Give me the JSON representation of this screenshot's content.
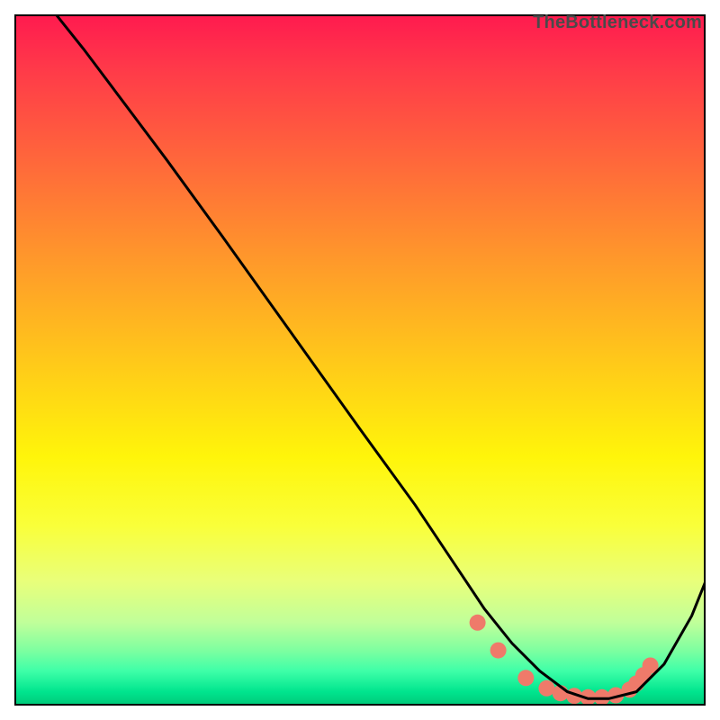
{
  "watermark": "TheBottleneck.com",
  "chart_data": {
    "type": "line",
    "title": "",
    "xlabel": "",
    "ylabel": "",
    "xlim": [
      0,
      100
    ],
    "ylim": [
      0,
      100
    ],
    "grid": false,
    "legend": false,
    "series": [
      {
        "name": "bottleneck-curve",
        "color": "#000000",
        "x": [
          6,
          10,
          16,
          22,
          30,
          40,
          50,
          58,
          64,
          68,
          72,
          76,
          80,
          83,
          86,
          90,
          94,
          98,
          100
        ],
        "y": [
          100,
          95,
          87,
          79,
          68,
          54,
          40,
          29,
          20,
          14,
          9,
          5,
          2,
          1,
          1,
          2,
          6,
          13,
          18
        ]
      }
    ],
    "markers": {
      "name": "highlight-dots",
      "color": "#ef7a6a",
      "radius": 9,
      "x": [
        67,
        70,
        74,
        77,
        79,
        81,
        83,
        85,
        87,
        89,
        90,
        91,
        92
      ],
      "y": [
        12,
        8,
        4,
        2.5,
        1.8,
        1.4,
        1.2,
        1.2,
        1.5,
        2.3,
        3.2,
        4.4,
        5.8
      ]
    },
    "background_gradient": {
      "top_color": "#ff1a4f",
      "mid_color": "#fff50a",
      "bottom_color": "#00c878"
    }
  }
}
